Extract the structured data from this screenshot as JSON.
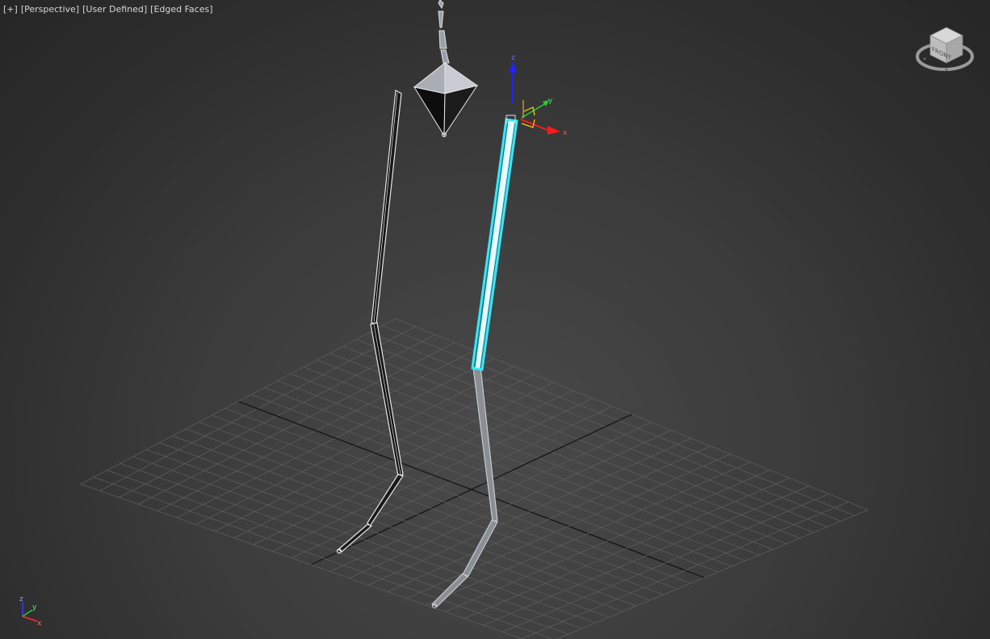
{
  "viewport": {
    "labels": {
      "plus": "[+]",
      "view": "[Perspective]",
      "shading_mode": "[User Defined]",
      "edge_mode": "[Edged Faces]"
    }
  },
  "gizmo": {
    "axes": {
      "x": "x",
      "y": "y",
      "z": "z"
    },
    "colors": {
      "x": "#ff1a1a",
      "y": "#2ecc2e",
      "z": "#2222ff",
      "plane": "#ffd400"
    }
  },
  "viewcube": {
    "face_label": "FRONT"
  },
  "world_axis": {
    "x": "x",
    "y": "y",
    "z": "z"
  },
  "selection": {
    "highlight_color": "#35e8ff"
  },
  "bones_color": "#dcdcdc"
}
